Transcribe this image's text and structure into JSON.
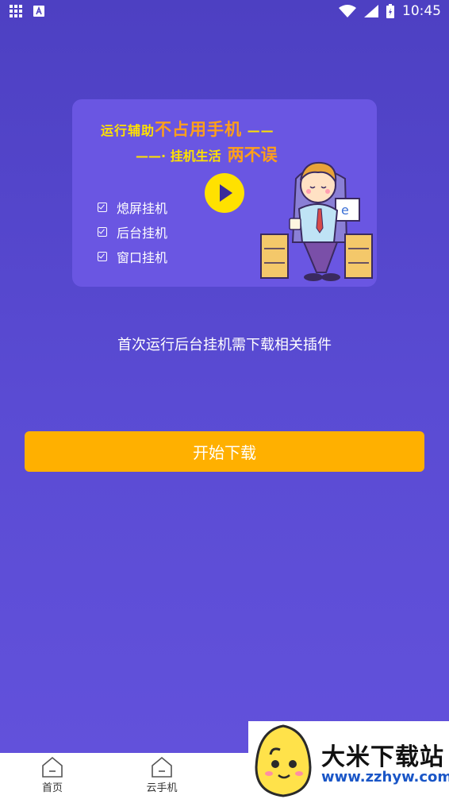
{
  "status_bar": {
    "time": "10:45",
    "icons": [
      "apps-grid-icon",
      "notification-a-icon",
      "wifi-icon",
      "signal-icon",
      "battery-charging-icon"
    ]
  },
  "banner": {
    "slogan_line1_prefix": "运行辅助",
    "slogan_line1_highlight": "不占用手机",
    "slogan_line2_prefix": "挂机生活",
    "slogan_line2_highlight": "两不误",
    "features": [
      "熄屏挂机",
      "后台挂机",
      "窗口挂机"
    ],
    "play_icon": "play-icon",
    "illustration": "man-at-desk-illustration"
  },
  "hint": "首次运行后台挂机需下载相关插件",
  "start_button_label": "开始下载",
  "bottom_nav": {
    "items": [
      {
        "label": "首页",
        "icon": "home-icon"
      },
      {
        "label": "云手机",
        "icon": "cloud-phone-icon"
      }
    ]
  },
  "watermark": {
    "title": "大米下载站",
    "url": "www.zzhyw.com"
  },
  "colors": {
    "background": "#5a4bd3",
    "banner": "#6a56e2",
    "accent_yellow": "#ffe100",
    "button": "#ffb000"
  }
}
